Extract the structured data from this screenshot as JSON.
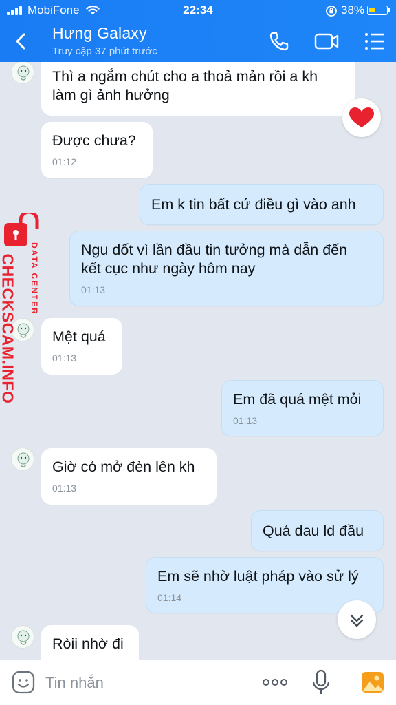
{
  "status_bar": {
    "carrier": "MobiFone",
    "time": "22:34",
    "battery": "38%"
  },
  "header": {
    "title": "Hưng Galaxy",
    "subtitle": "Truy cập 37 phút trước"
  },
  "messages": [
    {
      "dir": "in",
      "text_lines": [
        "Thì a ngắm chút cho a thoả mản rồi a kh",
        "làm gì ảnh hưởng"
      ],
      "time": ""
    },
    {
      "dir": "in",
      "text_lines": [
        "Được chưa?"
      ],
      "time": "01:12"
    },
    {
      "dir": "out",
      "text_lines": [
        "Em k tin bất cứ điều gì vào anh"
      ],
      "time": ""
    },
    {
      "dir": "out",
      "text_lines": [
        "Ngu dốt vì lần đầu tin tưởng mà dẫn đến",
        "kết cục như ngày hôm nay"
      ],
      "time": "01:13"
    },
    {
      "dir": "in",
      "text_lines": [
        "Mệt quá"
      ],
      "time": "01:13"
    },
    {
      "dir": "out",
      "text_lines": [
        "Em đã quá mệt mỏi"
      ],
      "time": "01:13"
    },
    {
      "dir": "in",
      "text_lines": [
        "Giờ có mở đèn lên kh"
      ],
      "time": "01:13"
    },
    {
      "dir": "out",
      "text_lines": [
        "Quá dau ld đầu"
      ],
      "time": ""
    },
    {
      "dir": "out",
      "text_lines": [
        "Em sẽ nhờ luật pháp vào sử lý"
      ],
      "time": "01:14"
    },
    {
      "dir": "in",
      "text_lines": [
        "Ròii nhờ đi"
      ],
      "time": ""
    }
  ],
  "watermark": {
    "main": "CHECKSCAM.INFO",
    "sub": "DATA CENTER"
  },
  "input": {
    "placeholder": "Tin nhắn"
  },
  "icons": {
    "back": "chevron-left-icon",
    "call": "phone-icon",
    "video": "video-camera-icon",
    "menu": "list-menu-icon",
    "reaction": "heart-icon",
    "scroll": "double-chevron-down-icon",
    "emoji": "smiley-icon",
    "more": "more-dots-icon",
    "mic": "microphone-icon",
    "image": "image-icon"
  },
  "colors": {
    "header": "#1a7cf4",
    "outgoing_bubble": "#d5ebfd",
    "incoming_bubble": "#ffffff",
    "background": "#e2e7ef",
    "heart": "#e8232f",
    "watermark": "#e8232f"
  }
}
